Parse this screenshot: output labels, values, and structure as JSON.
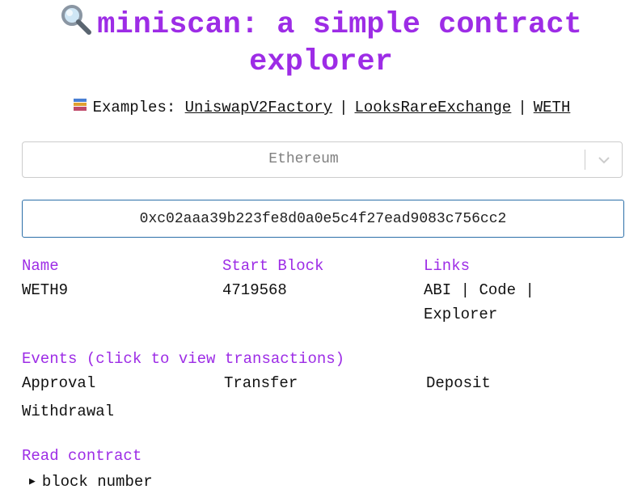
{
  "header": {
    "title_line1": "miniscan: a simple contract",
    "title_line2": "explorer",
    "title_icon": "magnifying-glass-icon"
  },
  "examples": {
    "label": "Examples:",
    "icon": "books-icon",
    "links": [
      "UniswapV2Factory",
      "LooksRareExchange",
      "WETH"
    ],
    "separator": "|"
  },
  "network_select": {
    "value": "Ethereum"
  },
  "address_input": {
    "value": "0xc02aaa39b223fe8d0a0e5c4f27ead9083c756cc2"
  },
  "contract_info": {
    "name_label": "Name",
    "name_value": "WETH9",
    "start_block_label": "Start Block",
    "start_block_value": "4719568",
    "links_label": "Links",
    "links": [
      "ABI",
      "Code",
      "Explorer"
    ],
    "links_separator": "|"
  },
  "events": {
    "label": "Events (click to view transactions)",
    "items": [
      "Approval",
      "Transfer",
      "Deposit",
      "Withdrawal"
    ]
  },
  "read_contract": {
    "label": "Read contract",
    "items": [
      "block number"
    ]
  },
  "colors": {
    "accent": "#9d2ce6",
    "input_border": "#2c6fa8",
    "select_border": "#cccccc"
  }
}
